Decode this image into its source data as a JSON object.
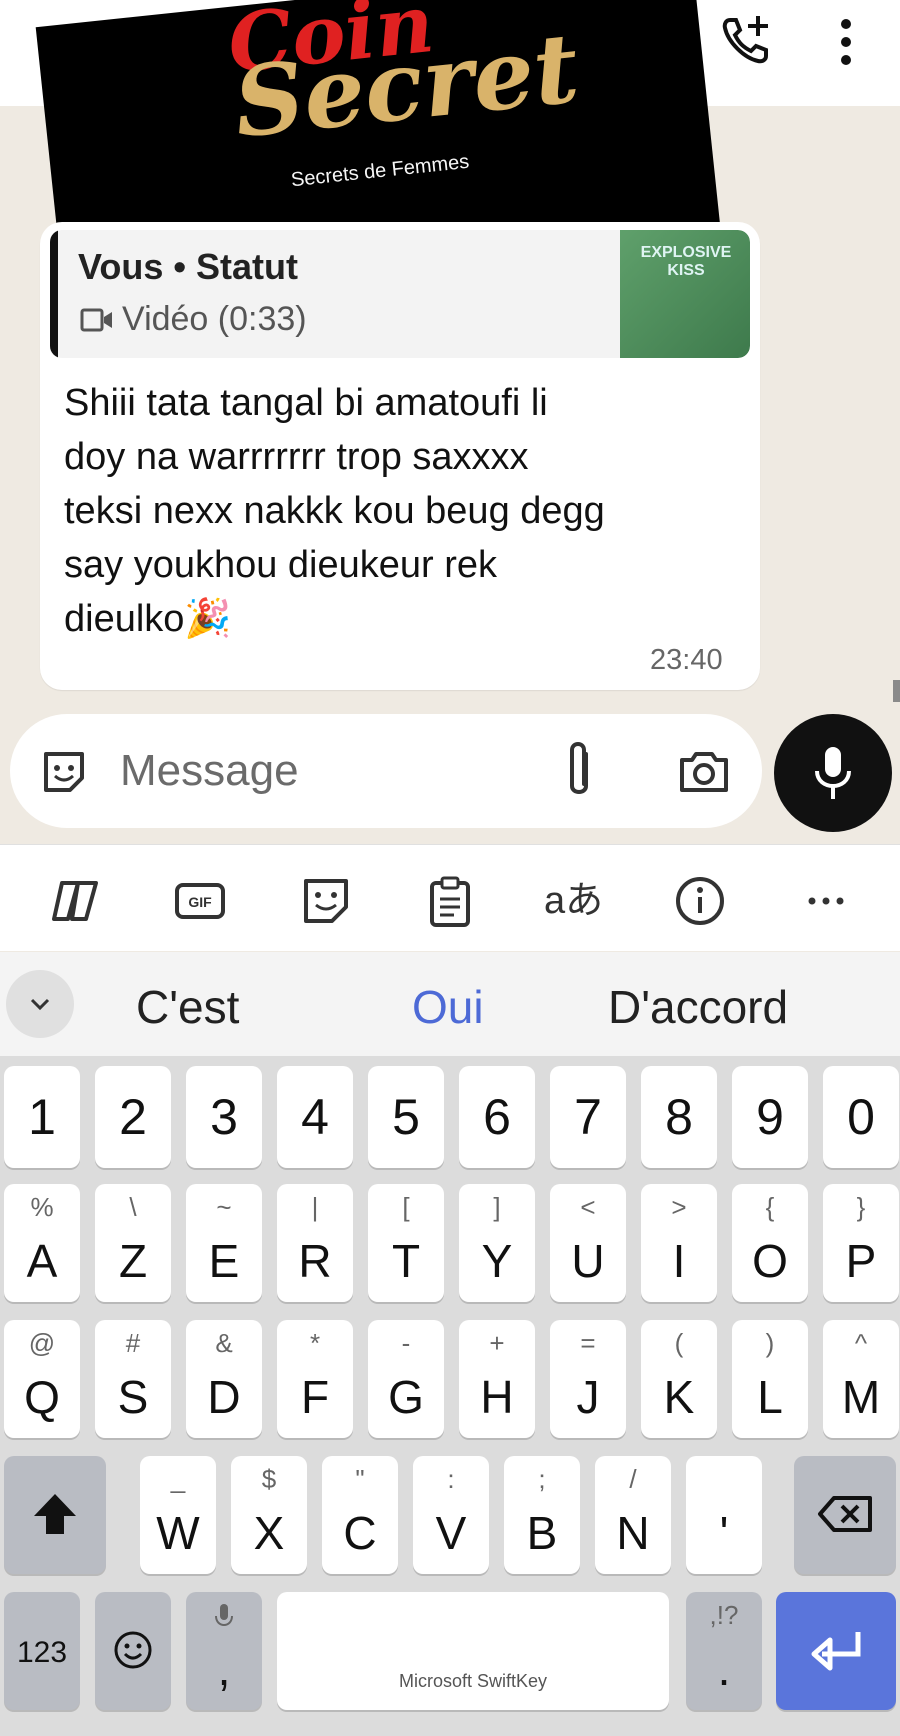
{
  "logo": {
    "line1": "Coin",
    "line2": "Secret",
    "tagline": "Secrets de Femmes"
  },
  "message": {
    "quote_author": "Vous • Statut",
    "quote_media": "Vidéo (0:33)",
    "quote_thumb_text": "EXPLOSIVE KISS",
    "text": "Shiii tata tangal bi amatoufi li\ndoy na warrrrrrr trop saxxxx\nteksi nexx nakkk kou beug degg\nsay youkhou dieukeur rek\ndieulko🎉",
    "time": "23:40"
  },
  "composer": {
    "placeholder": "Message"
  },
  "suggestions": [
    "C'est",
    "Oui",
    "D'accord"
  ],
  "keyboard": {
    "numbers": [
      "1",
      "2",
      "3",
      "4",
      "5",
      "6",
      "7",
      "8",
      "9",
      "0"
    ],
    "row1": [
      [
        "A",
        "%"
      ],
      [
        "Z",
        "\\"
      ],
      [
        "E",
        "~"
      ],
      [
        "R",
        "|"
      ],
      [
        "T",
        "["
      ],
      [
        "Y",
        "]"
      ],
      [
        "U",
        "<"
      ],
      [
        "I",
        ">"
      ],
      [
        "O",
        "{"
      ],
      [
        "P",
        "}"
      ]
    ],
    "row2": [
      [
        "Q",
        "@"
      ],
      [
        "S",
        "#"
      ],
      [
        "D",
        "&"
      ],
      [
        "F",
        "*"
      ],
      [
        "G",
        "-"
      ],
      [
        "H",
        "+"
      ],
      [
        "J",
        "="
      ],
      [
        "K",
        "("
      ],
      [
        "L",
        ")"
      ],
      [
        "M",
        "^"
      ]
    ],
    "row3": [
      [
        "W",
        "_"
      ],
      [
        "X",
        "$"
      ],
      [
        "C",
        "\""
      ],
      [
        "V",
        ":"
      ],
      [
        "B",
        ";"
      ],
      [
        "N",
        "/"
      ],
      [
        "'",
        ""
      ]
    ],
    "num_toggle": "123",
    "comma": ",",
    "space_label": "Microsoft SwiftKey",
    "punct_sub": ",!?",
    "punct": "."
  },
  "colors": {
    "accent": "#5a75db",
    "suggest_highlight": "#4d6ad6"
  }
}
